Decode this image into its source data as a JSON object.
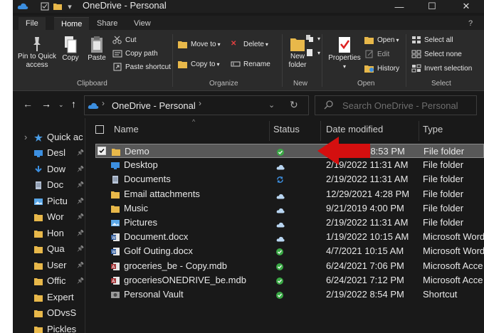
{
  "window": {
    "title": "OneDrive - Personal",
    "controls": {
      "minimize": "—",
      "maximize": "☐",
      "close": "✕"
    }
  },
  "tabs": [
    "File",
    "Home",
    "Share",
    "View"
  ],
  "ribbon": {
    "clipboard": {
      "pin": "Pin to Quick access",
      "copy": "Copy",
      "paste": "Paste",
      "cut": "Cut",
      "copy_path": "Copy path",
      "paste_shortcut": "Paste shortcut",
      "label": "Clipboard"
    },
    "organize": {
      "move_to": "Move to",
      "delete": "Delete",
      "copy_to": "Copy to",
      "rename": "Rename",
      "label": "Organize"
    },
    "new": {
      "new_folder": "New folder",
      "label": "New"
    },
    "open": {
      "properties": "Properties",
      "open": "Open",
      "edit": "Edit",
      "history": "History",
      "label": "Open"
    },
    "select": {
      "select_all": "Select all",
      "select_none": "Select none",
      "invert": "Invert selection",
      "label": "Select"
    }
  },
  "address": {
    "path": "OneDrive - Personal",
    "search_placeholder": "Search OneDrive - Personal"
  },
  "nav": [
    {
      "label": "Quick ac",
      "icon": "star-icon",
      "color": "#4a9ee8",
      "pinned": false
    },
    {
      "label": "Desl",
      "icon": "desktop-icon",
      "color": "#3c8fe0",
      "pinned": true
    },
    {
      "label": "Dow",
      "icon": "download-icon",
      "color": "#3c8fe0",
      "pinned": true
    },
    {
      "label": "Doc",
      "icon": "documents-icon",
      "color": "#b8c4d6",
      "pinned": true
    },
    {
      "label": "Pictu",
      "icon": "pictures-icon",
      "color": "#5aa7e8",
      "pinned": true
    },
    {
      "label": "Wor",
      "icon": "folder-icon",
      "color": "#e8b84a",
      "pinned": true
    },
    {
      "label": "Hon",
      "icon": "folder-icon",
      "color": "#e8b84a",
      "pinned": true
    },
    {
      "label": "Qua",
      "icon": "folder-icon",
      "color": "#e8b84a",
      "pinned": true
    },
    {
      "label": "User",
      "icon": "folder-icon",
      "color": "#e8b84a",
      "pinned": true
    },
    {
      "label": "Offic",
      "icon": "folder-icon",
      "color": "#e8b84a",
      "pinned": true
    },
    {
      "label": "Expert",
      "icon": "folder-icon",
      "color": "#e8b84a",
      "pinned": false
    },
    {
      "label": "ODvsS",
      "icon": "folder-icon",
      "color": "#e8b84a",
      "pinned": false
    },
    {
      "label": "Pickles",
      "icon": "folder-icon",
      "color": "#e8b84a",
      "pinned": false
    }
  ],
  "columns": [
    "Name",
    "Status",
    "Date modified",
    "Type"
  ],
  "files": [
    {
      "name": "Demo",
      "status": "available",
      "date": "2/19/2022 8:53 PM",
      "type": "File folder",
      "icon": "folder-icon",
      "selected": true
    },
    {
      "name": "Desktop",
      "status": "cloud",
      "date": "2/19/2022 11:31 AM",
      "type": "File folder",
      "icon": "desktop-icon",
      "selected": false
    },
    {
      "name": "Documents",
      "status": "syncing",
      "date": "2/19/2022 11:31 AM",
      "type": "File folder",
      "icon": "documents-icon",
      "selected": false
    },
    {
      "name": "Email attachments",
      "status": "cloud",
      "date": "12/29/2021 4:28 PM",
      "type": "File folder",
      "icon": "folder-icon",
      "selected": false
    },
    {
      "name": "Music",
      "status": "cloud",
      "date": "9/21/2019 4:00 PM",
      "type": "File folder",
      "icon": "folder-icon",
      "selected": false
    },
    {
      "name": "Pictures",
      "status": "cloud",
      "date": "2/19/2022 11:31 AM",
      "type": "File folder",
      "icon": "pictures-icon",
      "selected": false
    },
    {
      "name": "Document.docx",
      "status": "cloud",
      "date": "1/19/2022 10:15 AM",
      "type": "Microsoft Word",
      "icon": "word-icon",
      "selected": false
    },
    {
      "name": "Golf Outing.docx",
      "status": "available",
      "date": "4/7/2021 10:15 AM",
      "type": "Microsoft Word",
      "icon": "word-icon",
      "selected": false
    },
    {
      "name": "groceries_be - Copy.mdb",
      "status": "available",
      "date": "6/24/2021 7:06 PM",
      "type": "Microsoft Acce",
      "icon": "access-icon",
      "selected": false
    },
    {
      "name": "groceriesONEDRIVE_be.mdb",
      "status": "available",
      "date": "6/24/2021 7:12 PM",
      "type": "Microsoft Acce",
      "icon": "access-icon",
      "selected": false
    },
    {
      "name": "Personal Vault",
      "status": "available",
      "date": "2/19/2022 8:54 PM",
      "type": "Shortcut",
      "icon": "vault-icon",
      "selected": false
    }
  ],
  "colors": {
    "available": "#3aa845",
    "cloud": "#b9d6f2",
    "syncing": "#3c8fe0",
    "folder": "#e8b84a",
    "arrow": "#d40f0f"
  }
}
